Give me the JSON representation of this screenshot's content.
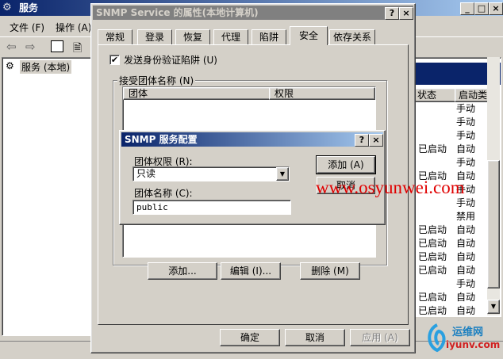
{
  "services_window": {
    "title": "服务",
    "menu": [
      "文件 (F)",
      "操作 (A)"
    ],
    "tree_item": "服务 (本地)",
    "columns": {
      "status": "状态",
      "startup": "启动类型"
    },
    "rows": [
      {
        "status": "",
        "startup": "手动"
      },
      {
        "status": "",
        "startup": "手动"
      },
      {
        "status": "",
        "startup": "手动"
      },
      {
        "status": "已启动",
        "startup": "自动"
      },
      {
        "status": "",
        "startup": "手动"
      },
      {
        "status": "已启动",
        "startup": "自动"
      },
      {
        "status": "",
        "startup": "手动"
      },
      {
        "status": "",
        "startup": "手动"
      },
      {
        "status": "",
        "startup": "禁用"
      },
      {
        "status": "已启动",
        "startup": "自动"
      },
      {
        "status": "已启动",
        "startup": "自动"
      },
      {
        "status": "已启动",
        "startup": "自动"
      },
      {
        "status": "已启动",
        "startup": "自动"
      },
      {
        "status": "",
        "startup": "手动"
      },
      {
        "status": "已启动",
        "startup": "自动"
      },
      {
        "status": "已启动",
        "startup": "自动"
      }
    ]
  },
  "properties_dialog": {
    "title": "SNMP Service 的属性(本地计算机)",
    "help_button": "?",
    "close_button": "×",
    "tabs": [
      "常规",
      "登录",
      "恢复",
      "代理",
      "陷阱",
      "安全",
      "依存关系"
    ],
    "send_auth_trap": "发送身份验证陷阱 (U)",
    "accepted_communities_label": "接受团体名称 (N)",
    "list_columns": [
      "团体",
      "权限"
    ],
    "add_button": "添加...",
    "edit_button": "编辑 (I)...",
    "remove_button": "删除 (M)",
    "ok_button": "确定",
    "cancel_button": "取消",
    "apply_button": "应用 (A)"
  },
  "snmp_config_dialog": {
    "title": "SNMP 服务配置",
    "help_button": "?",
    "close_button": "×",
    "rights_label": "团体权限 (R):",
    "rights_value": "只读",
    "name_label": "团体名称 (C):",
    "name_value": "public",
    "add_button": "添加 (A)",
    "cancel_button": "取消"
  },
  "watermark": {
    "site_text": "www.osyunwei.com",
    "logo_text": "运维网",
    "logo_url_text": "iyunv.com"
  },
  "colors": {
    "active_title": "#0a246a",
    "inactive_title": "#808080",
    "watermark_red": "#e00000"
  }
}
